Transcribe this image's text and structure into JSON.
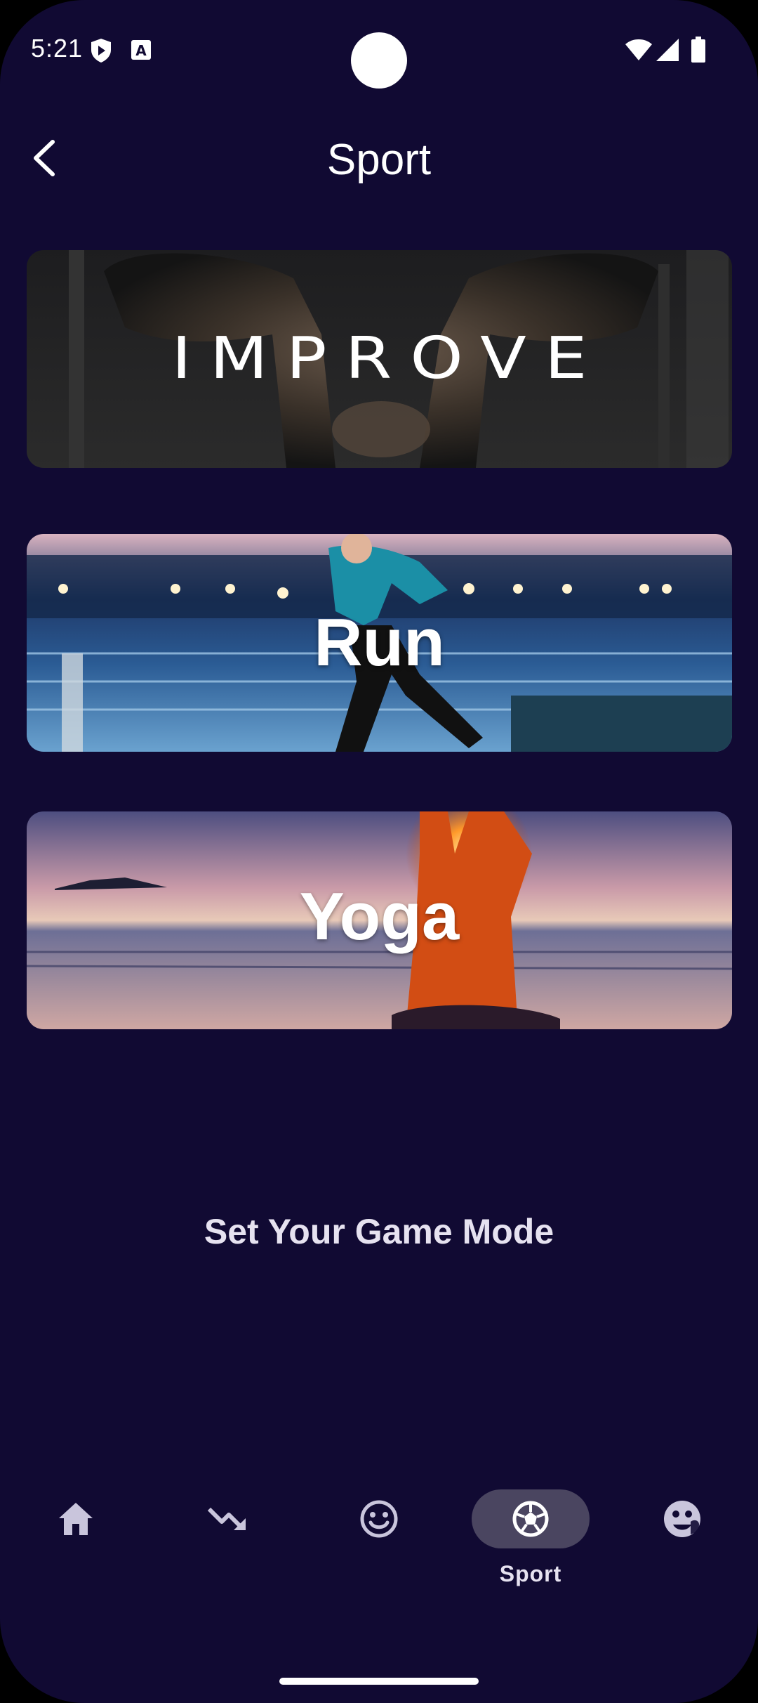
{
  "status_bar": {
    "time": "5:21"
  },
  "header": {
    "title": "Sport"
  },
  "cards": [
    {
      "label": "IMPROVE"
    },
    {
      "label": "Run"
    },
    {
      "label": "Yoga"
    }
  ],
  "game_mode": {
    "text": "Set Your Game Mode"
  },
  "bottom_nav": {
    "items": [
      {
        "icon": "home-icon",
        "label": "",
        "active": false
      },
      {
        "icon": "trending-down-icon",
        "label": "",
        "active": false
      },
      {
        "icon": "smiley-icon",
        "label": "",
        "active": false
      },
      {
        "icon": "soccer-ball-icon",
        "label": "Sport",
        "active": true
      },
      {
        "icon": "mood-icon",
        "label": "",
        "active": false
      }
    ]
  },
  "colors": {
    "background": "#110a33",
    "nav_active_pill": "#4a4560",
    "text": "#ffffff",
    "muted_text": "#e6e2f0"
  }
}
